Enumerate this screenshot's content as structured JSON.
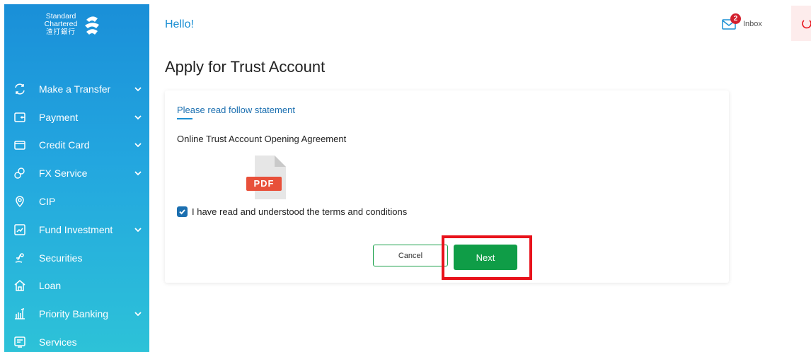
{
  "brand": {
    "line1": "Standard",
    "line2": "Chartered",
    "line3": "渣打銀行"
  },
  "sidebar": {
    "items": [
      {
        "label": "Make a Transfer",
        "icon": "transfer-icon",
        "expandable": true
      },
      {
        "label": "Payment",
        "icon": "wallet-icon",
        "expandable": true
      },
      {
        "label": "Credit Card",
        "icon": "credit-card-icon",
        "expandable": true
      },
      {
        "label": "FX Service",
        "icon": "fx-icon",
        "expandable": true
      },
      {
        "label": "CIP",
        "icon": "cip-icon",
        "expandable": false
      },
      {
        "label": "Fund Investment",
        "icon": "fund-icon",
        "expandable": true
      },
      {
        "label": "Securities",
        "icon": "securities-icon",
        "expandable": false
      },
      {
        "label": "Loan",
        "icon": "loan-icon",
        "expandable": false
      },
      {
        "label": "Priority Banking",
        "icon": "priority-banking-icon",
        "expandable": true
      },
      {
        "label": "Services",
        "icon": "services-icon",
        "expandable": false
      }
    ]
  },
  "header": {
    "greeting": "Hello!",
    "inbox_label": "Inbox",
    "inbox_count": "2"
  },
  "main": {
    "title": "Apply for Trust Account",
    "section_link": "Please read follow statement",
    "document_title": "Online Trust Account Opening Agreement",
    "pdf_label": "PDF",
    "checkbox_label": "I have read and understood the terms and conditions",
    "checkbox_checked": true,
    "cancel_label": "Cancel",
    "next_label": "Next"
  },
  "colors": {
    "brand_blue": "#1b8fd3",
    "primary_green": "#0f9d47",
    "highlight_red": "#e8121b",
    "badge_red": "#d3202e"
  }
}
